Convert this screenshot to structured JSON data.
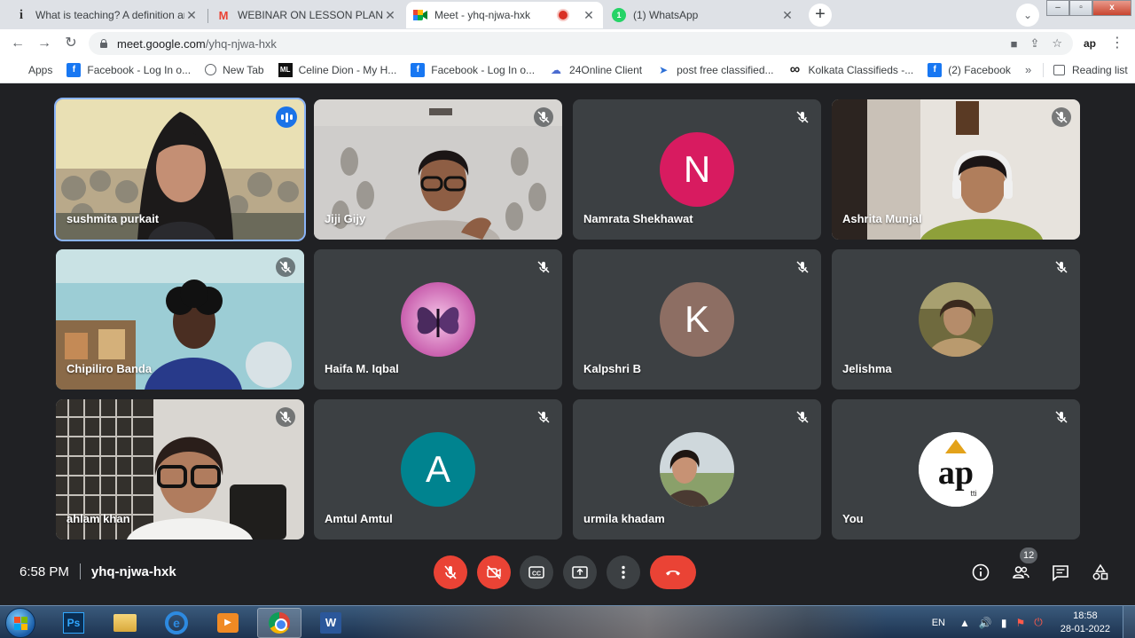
{
  "browser": {
    "tabs": [
      {
        "title": "What is teaching? A definition and",
        "favicon": "infed-i-icon",
        "active": false
      },
      {
        "title": "WEBINAR ON LESSON PLAN ON",
        "favicon": "gmail-icon",
        "active": false
      },
      {
        "title": "Meet - yhq-njwa-hxk",
        "favicon": "meet-icon",
        "active": true,
        "recording": true
      },
      {
        "title": "(1) WhatsApp",
        "favicon": "whatsapp-icon",
        "active": false
      }
    ],
    "url_host": "meet.google.com",
    "url_path": "/yhq-njwa-hxk",
    "profile_initials": "ap",
    "bookmarks": [
      {
        "label": "Apps",
        "icon": "apps-grid-icon"
      },
      {
        "label": "Facebook - Log In o...",
        "icon": "facebook-icon"
      },
      {
        "label": "New Tab",
        "icon": "globe-icon"
      },
      {
        "label": "Celine Dion - My H...",
        "icon": "ml-icon"
      },
      {
        "label": "Facebook - Log In o...",
        "icon": "facebook-icon"
      },
      {
        "label": "24Online Client",
        "icon": "24online-icon"
      },
      {
        "label": "post free classified...",
        "icon": "post-icon"
      },
      {
        "label": "Kolkata Classifieds -...",
        "icon": "infinity-icon"
      },
      {
        "label": "(2) Facebook",
        "icon": "facebook-icon"
      }
    ],
    "bookmarks_overflow": "»",
    "reading_list": "Reading list"
  },
  "meet": {
    "participants": [
      {
        "name": "sushmita purkait",
        "kind": "video",
        "speaking": true
      },
      {
        "name": "Jiji Gijy",
        "kind": "video",
        "muted": true
      },
      {
        "name": "Namrata Shekhawat",
        "kind": "letter",
        "letter": "N",
        "color": "#d81b60",
        "muted": true
      },
      {
        "name": "Ashrita Munjal",
        "kind": "video",
        "muted": true
      },
      {
        "name": "Chipiliro Banda",
        "kind": "video",
        "muted": true
      },
      {
        "name": "Haifa M. Iqbal",
        "kind": "photo",
        "muted": true
      },
      {
        "name": "Kalpshri B",
        "kind": "letter",
        "letter": "K",
        "color": "#8d6e63",
        "muted": true
      },
      {
        "name": "Jelishma",
        "kind": "photo",
        "muted": true
      },
      {
        "name": "ahlam khan",
        "kind": "video",
        "muted": true
      },
      {
        "name": "Amtul Amtul",
        "kind": "letter",
        "letter": "A",
        "color": "#00838f",
        "muted": true
      },
      {
        "name": "urmila khadam",
        "kind": "photo",
        "muted": true
      },
      {
        "name": "You",
        "kind": "logo",
        "muted": true
      }
    ],
    "time": "6:58 PM",
    "meeting_code": "yhq-njwa-hxk",
    "people_count": "12",
    "logo_text": "ap",
    "logo_sub": "tti"
  },
  "taskbar": {
    "language": "EN",
    "clock_time": "18:58",
    "clock_date": "28-01-2022",
    "apps": [
      "photoshop-icon",
      "folder-icon",
      "internet-explorer-icon",
      "media-player-icon",
      "chrome-icon",
      "word-icon"
    ]
  }
}
